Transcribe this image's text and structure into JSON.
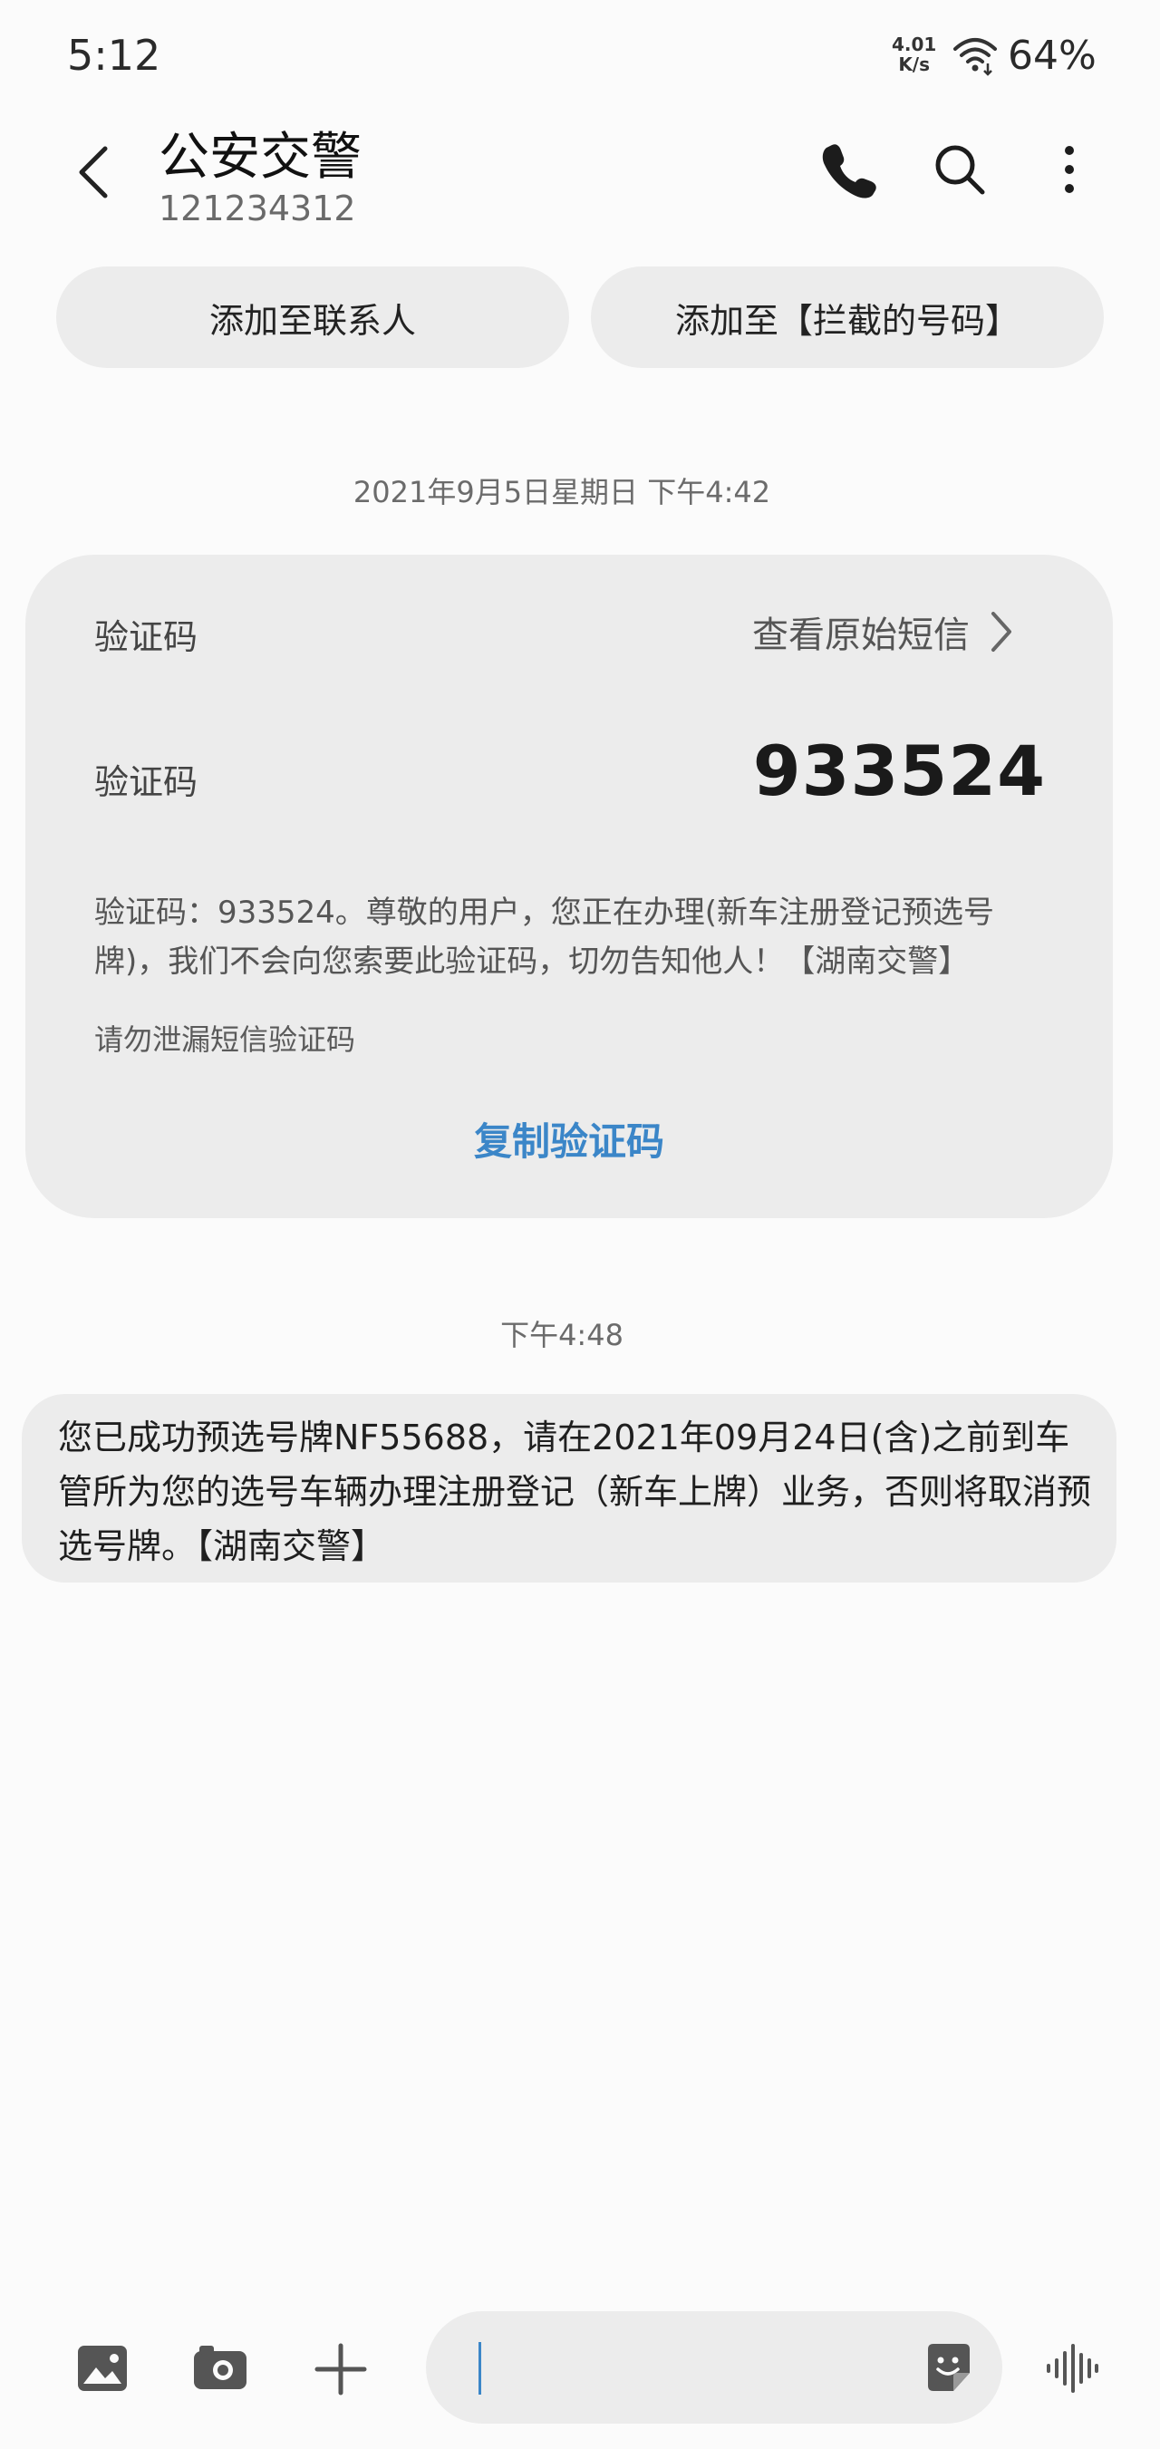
{
  "status_bar": {
    "time": "5:12",
    "speed_value": "4.01",
    "speed_unit": "K/s",
    "battery": "64%"
  },
  "header": {
    "contact_name": "公安交警",
    "contact_number": "121234312",
    "icons": [
      "back-icon",
      "phone-icon",
      "search-icon",
      "more-vert-icon"
    ]
  },
  "actions": {
    "add_contact": "添加至联系人",
    "block_number": "添加至【拦截的号码】"
  },
  "messages": [
    {
      "timestamp": "2021年9月5日星期日 下午4:42",
      "card": {
        "label": "验证码",
        "view_original": "查看原始短信",
        "code_label": "验证码",
        "code": "933524",
        "body": "验证码：933524。尊敬的用户，您正在办理(新车注册登记预选号牌)，我们不会向您索要此验证码，切勿告知他人！【湖南交警】",
        "warning": "请勿泄漏短信验证码",
        "copy_button": "复制验证码"
      }
    },
    {
      "timestamp": "下午4:48",
      "text": "您已成功预选号牌NF55688，请在2021年09月24日(含)之前到车管所为您的选号车辆办理注册登记（新车上牌）业务，否则将取消预选号牌。【湖南交警】"
    }
  ],
  "composer": {
    "icons": [
      "image-icon",
      "camera-icon",
      "plus-icon",
      "sticker-icon",
      "voice-icon"
    ]
  },
  "colors": {
    "accent": "#3b86c8",
    "bubble": "#ececec",
    "background": "#fbfbfb"
  }
}
